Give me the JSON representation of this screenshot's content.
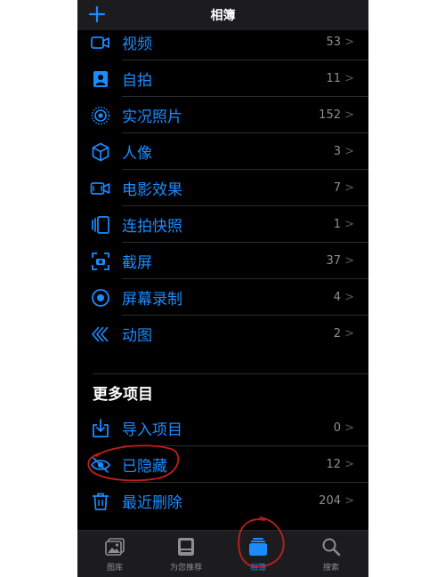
{
  "header": {
    "title": "相簿",
    "add_icon": "plus-icon"
  },
  "media_types": [
    {
      "label": "视频",
      "count": "53",
      "icon": "video-icon"
    },
    {
      "label": "自拍",
      "count": "11",
      "icon": "selfie-icon"
    },
    {
      "label": "实况照片",
      "count": "152",
      "icon": "live-photo-icon"
    },
    {
      "label": "人像",
      "count": "3",
      "icon": "portrait-cube-icon"
    },
    {
      "label": "电影效果",
      "count": "7",
      "icon": "cinematic-icon"
    },
    {
      "label": "连拍快照",
      "count": "1",
      "icon": "burst-icon"
    },
    {
      "label": "截屏",
      "count": "37",
      "icon": "screenshot-icon"
    },
    {
      "label": "屏幕录制",
      "count": "4",
      "icon": "screen-recording-icon"
    },
    {
      "label": "动图",
      "count": "2",
      "icon": "animated-icon"
    }
  ],
  "more_items": {
    "title": "更多项目",
    "rows": [
      {
        "label": "导入项目",
        "count": "0",
        "icon": "import-icon"
      },
      {
        "label": "已隐藏",
        "count": "12",
        "icon": "hidden-eye-icon"
      },
      {
        "label": "最近删除",
        "count": "204",
        "icon": "trash-icon"
      }
    ]
  },
  "tabbar": {
    "tabs": [
      {
        "label": "图库",
        "icon": "library-icon",
        "active": false
      },
      {
        "label": "为您推荐",
        "icon": "for-you-icon",
        "active": false
      },
      {
        "label": "相簿",
        "icon": "albums-icon",
        "active": true
      },
      {
        "label": "搜索",
        "icon": "search-icon",
        "active": false
      }
    ]
  },
  "colors": {
    "accent": "#1a8cff",
    "background": "#000000",
    "annotation": "#c0201e"
  }
}
